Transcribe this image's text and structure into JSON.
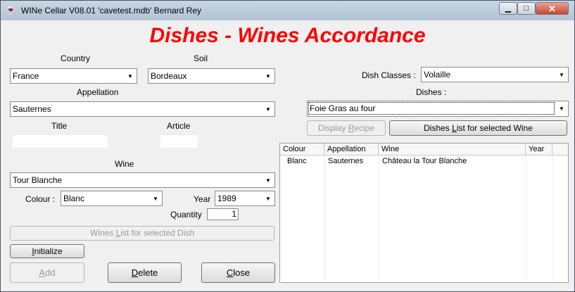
{
  "window": {
    "title": "WINe Cellar V08.01 'cavetest.mdb'   Bernard Rey",
    "minimize_glyph": "▁",
    "maximize_glyph": "□",
    "close_glyph": "✕",
    "app_icon_glyph": "🍷"
  },
  "heading": "Dishes - Wines Accordance",
  "left": {
    "country": {
      "label": "Country",
      "value": "France"
    },
    "soil": {
      "label": "Soil",
      "value": "Bordeaux"
    },
    "appellation": {
      "label": "Appellation",
      "value": "Sauternes"
    },
    "title": {
      "label": "Title",
      "value": ""
    },
    "article": {
      "label": "Article",
      "value": ""
    },
    "wine": {
      "label": "Wine",
      "value": "Tour Blanche"
    },
    "colour": {
      "label": "Colour :",
      "value": "Blanc"
    },
    "year": {
      "label": "Year",
      "value": "1989"
    },
    "quantity": {
      "label": "Quantity",
      "value": "1"
    },
    "wines_list_button": {
      "pre": "Wines ",
      "u": "L",
      "post": "ist for selected Dish"
    },
    "initialize_button": {
      "u": "I",
      "post": "nitialize"
    },
    "add_button": {
      "u": "A",
      "post": "dd"
    },
    "delete_button": {
      "u": "D",
      "post": "elete"
    },
    "close_button": {
      "u": "C",
      "post": "lose"
    }
  },
  "right": {
    "dish_classes": {
      "label": "Dish Classes :",
      "value": "Volaille"
    },
    "dishes": {
      "label": "Dishes :",
      "value": "Foie Gras au four"
    },
    "display_recipe_button": {
      "pre": "Display ",
      "u": "R",
      "post": "ecipe"
    },
    "dishes_list_button": {
      "pre": "Dishes ",
      "u": "L",
      "post": "ist for selected Wine"
    },
    "list": {
      "columns": [
        "Colour",
        "Appellation",
        "Wine",
        "Year"
      ],
      "rows": [
        {
          "colour": "Blanc",
          "appellation": "Sauternes",
          "wine": "Château  la Tour Blanche",
          "year": ""
        }
      ]
    }
  },
  "icons": {
    "dropdown_arrow": "▼"
  }
}
